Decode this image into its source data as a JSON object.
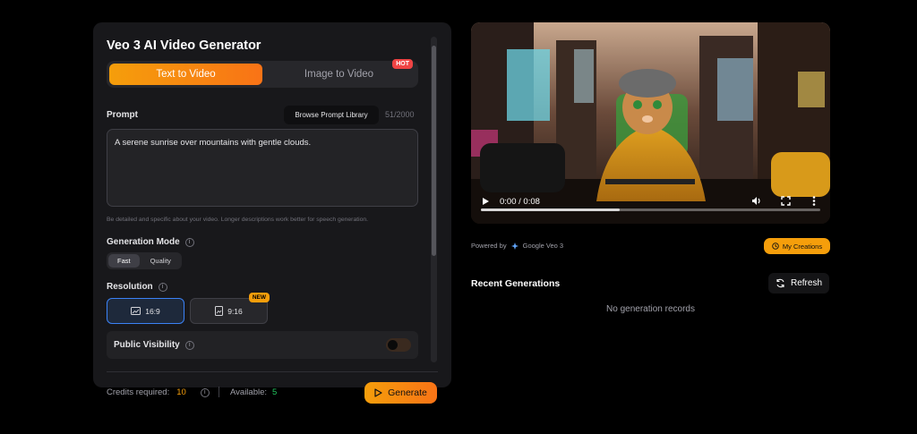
{
  "app": {
    "title": "Veo 3 AI Video Generator"
  },
  "mode_tabs": [
    {
      "label": "Text to Video",
      "active": true
    },
    {
      "label": "Image to Video",
      "active": false,
      "badge": "HOT"
    }
  ],
  "prompt": {
    "label": "Prompt",
    "browse_label": "Browse Prompt Library",
    "char_count": "51/2000",
    "value": "A serene sunrise over mountains with gentle clouds.",
    "hint": "Be detailed and specific about your video. Longer descriptions work better for speech generation."
  },
  "generation_mode": {
    "label": "Generation Mode",
    "options": [
      "Fast",
      "Quality"
    ],
    "selected": "Fast"
  },
  "resolution": {
    "label": "Resolution",
    "options": [
      {
        "label": "16:9",
        "selected": true
      },
      {
        "label": "9:16",
        "selected": false,
        "badge": "NEW"
      }
    ]
  },
  "visibility": {
    "label": "Public Visibility",
    "enabled": false
  },
  "footer": {
    "credits_label": "Credits required:",
    "credits_value": "10",
    "available_label": "Available:",
    "available_value": "5",
    "generate_label": "Generate"
  },
  "video": {
    "time": "0:00 / 0:08",
    "progress": 0.41
  },
  "powered": {
    "prefix": "Powered by",
    "name": "Google Veo 3"
  },
  "my_creations_label": "My Creations",
  "recent": {
    "title": "Recent Generations",
    "refresh_label": "Refresh",
    "empty_text": "No generation records"
  },
  "colors": {
    "accent": "#f59e0b",
    "accent_end": "#f97316",
    "panel_bg": "#18181b",
    "selection_blue": "#3b82f6",
    "available_green": "#22c55e",
    "hot_red": "#ef4444"
  }
}
